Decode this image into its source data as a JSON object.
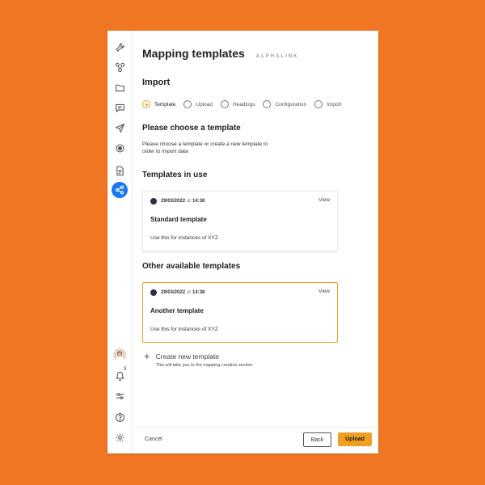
{
  "app": {
    "title": "Mapping templates",
    "brand": "ALPHALINK"
  },
  "import": {
    "heading": "Import",
    "steps": [
      {
        "label": "Template",
        "active": true
      },
      {
        "label": "Upload",
        "active": false
      },
      {
        "label": "Headings",
        "active": false
      },
      {
        "label": "Configuration",
        "active": false
      },
      {
        "label": "Import",
        "active": false
      }
    ],
    "choose_title": "Please choose a template",
    "choose_desc": "Please choose a template or create a new template in order to import data"
  },
  "in_use": {
    "heading": "Templates in use",
    "card": {
      "date": "29/03/2022",
      "at": "at",
      "time": "14:38",
      "view": "View",
      "title": "Standard template",
      "desc": "Use this for instances of XYZ"
    }
  },
  "available": {
    "heading": "Other available templates",
    "card": {
      "date": "29/03/2022",
      "at": "at",
      "time": "14:38",
      "view": "View",
      "title": "Another template",
      "desc": "Use this for instances of XYZ"
    }
  },
  "create": {
    "label": "Create new template",
    "hint": "This will take you to the mapping creation section"
  },
  "sidebar": {
    "icons": [
      "wrench-icon",
      "network-icon",
      "folder-icon",
      "chat-icon",
      "send-icon",
      "target-icon",
      "document-icon",
      "share-icon"
    ],
    "notification_count": "3",
    "bottom_icons": [
      "bell-icon",
      "sliders-icon",
      "help-icon",
      "settings-icon"
    ]
  },
  "footer": {
    "cancel": "Cancel",
    "back": "Back",
    "upload": "Upload"
  },
  "colors": {
    "background": "#ef7622",
    "accent": "#f0a021",
    "active_nav": "#1877f2"
  }
}
